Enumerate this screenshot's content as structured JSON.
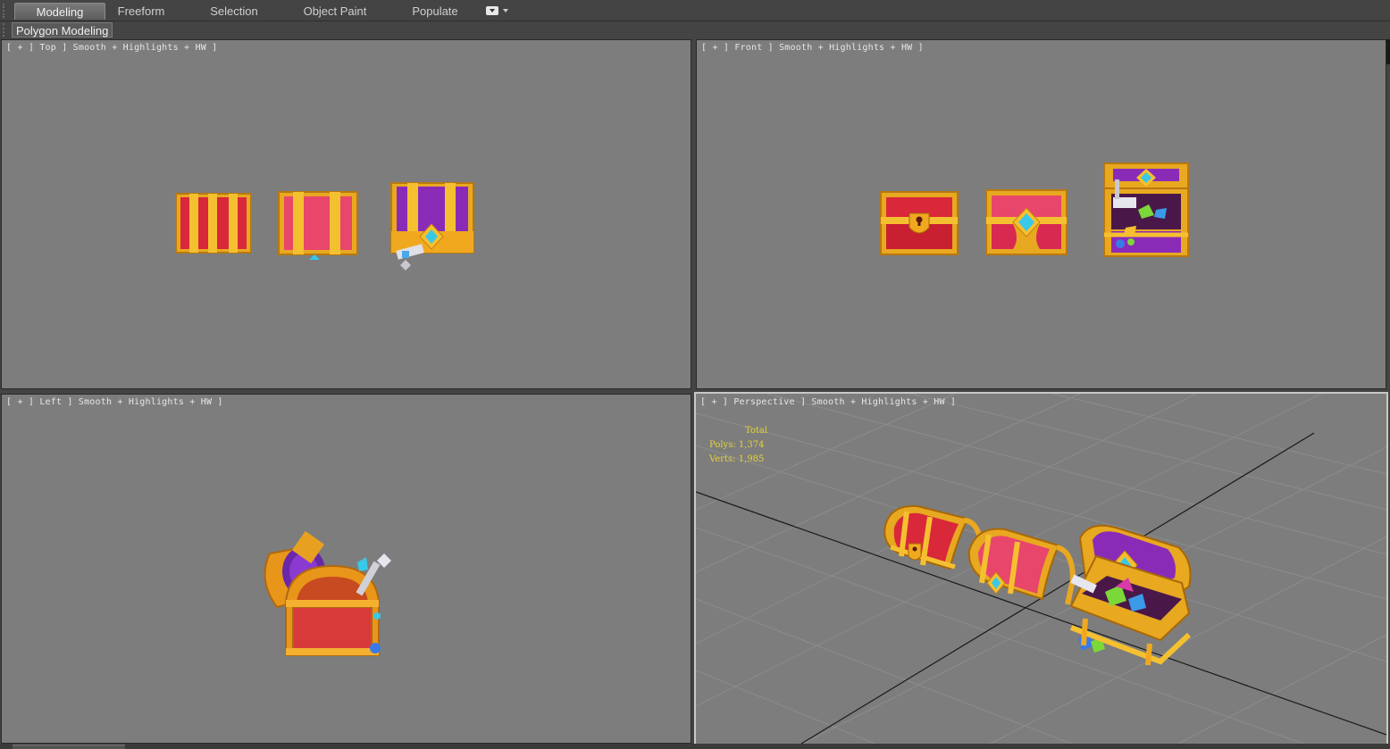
{
  "ribbon": {
    "tabs": [
      {
        "label": "Modeling",
        "active": true
      },
      {
        "label": "Freeform",
        "active": false
      },
      {
        "label": "Selection",
        "active": false
      },
      {
        "label": "Object Paint",
        "active": false
      },
      {
        "label": "Populate",
        "active": false
      }
    ],
    "more_icon": "dropdown-icon"
  },
  "subbar": {
    "panel_label": "Polygon Modeling"
  },
  "viewports": {
    "top": {
      "label": "[ + ] Top ] Smooth + Highlights + HW ]"
    },
    "front": {
      "label": "[ + ] Front ] Smooth + Highlights + HW ]"
    },
    "left": {
      "label": "[ + ] Left ] Smooth + Highlights + HW ]"
    },
    "perspective": {
      "label": "[ + ] Perspective ] Smooth + Highlights + HW ]",
      "stats": {
        "title": "Total",
        "polys_label": "Polys:",
        "polys_value": "1,374",
        "verts_label": "Verts:",
        "verts_value": "1,985"
      }
    }
  },
  "colors": {
    "viewport_bg": "#7d7d7d",
    "gold": "#f0a91f",
    "red": "#d8283a",
    "pink": "#e8466a",
    "purple": "#8a2bb8",
    "gem": "#38c8e8",
    "stats_text": "#e6d23a"
  }
}
